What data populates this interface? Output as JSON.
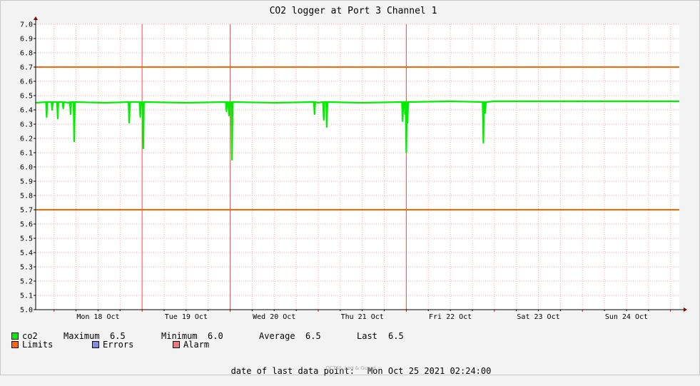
{
  "chart_data": {
    "type": "line",
    "title": "CO2 logger at Port 3 Channel 1",
    "x_tick_labels": [
      "Mon 18 Oct",
      "Tue 19 Oct",
      "Wed 20 Oct",
      "Thu 21 Oct",
      "Fri 22 Oct",
      "Sat 23 Oct",
      "Sun 24 Oct"
    ],
    "xlim": [
      "2021-10-17 19:00",
      "2021-10-25 02:24"
    ],
    "ylim": [
      5.0,
      7.0
    ],
    "y_ticks": [
      "5.0",
      "5.1",
      "5.2",
      "5.3",
      "5.4",
      "5.5",
      "5.6",
      "5.7",
      "5.8",
      "5.9",
      "6.0",
      "6.1",
      "6.2",
      "6.3",
      "6.4",
      "6.5",
      "6.6",
      "6.7",
      "6.8",
      "6.9",
      "7.0"
    ],
    "grid": true,
    "limits": [
      5.7,
      6.7
    ],
    "alarm_times": [
      "2021-10-19 00:00",
      "2021-10-20 00:00",
      "2021-10-22 00:00"
    ],
    "series": [
      {
        "name": "co2",
        "color": "#00ee00",
        "baseline": 6.455,
        "points": [
          [
            "2021-10-17 19:00",
            6.45
          ],
          [
            "2021-10-18 04:00",
            6.45
          ],
          [
            "2021-10-18 14:00",
            6.45
          ],
          [
            "2021-10-19 00:00",
            6.45
          ],
          [
            "2021-10-19 12:00",
            6.45
          ],
          [
            "2021-10-20 00:00",
            6.45
          ],
          [
            "2021-10-20 12:00",
            6.45
          ],
          [
            "2021-10-21 00:00",
            6.45
          ],
          [
            "2021-10-21 12:00",
            6.45
          ],
          [
            "2021-10-22 00:00",
            6.46
          ],
          [
            "2021-10-22 12:00",
            6.46
          ],
          [
            "2021-10-23 00:00",
            6.46
          ],
          [
            "2021-10-23 12:00",
            6.46
          ],
          [
            "2021-10-24 00:00",
            6.46
          ],
          [
            "2021-10-24 12:00",
            6.46
          ],
          [
            "2021-10-25 02:24",
            6.46
          ]
        ],
        "dips": [
          [
            "2021-10-17 22:00",
            6.35
          ],
          [
            "2021-10-17 23:30",
            6.4
          ],
          [
            "2021-10-18 01:00",
            6.34
          ],
          [
            "2021-10-18 02:30",
            6.41
          ],
          [
            "2021-10-18 04:30",
            6.37
          ],
          [
            "2021-10-18 05:30",
            6.18
          ],
          [
            "2021-10-18 20:30",
            6.31
          ],
          [
            "2021-10-18 23:30",
            6.35
          ],
          [
            "2021-10-19 00:20",
            6.13
          ],
          [
            "2021-10-19 23:00",
            6.39
          ],
          [
            "2021-10-19 23:40",
            6.36
          ],
          [
            "2021-10-20 00:30",
            6.05
          ],
          [
            "2021-10-20 23:00",
            6.37
          ],
          [
            "2021-10-21 01:30",
            6.33
          ],
          [
            "2021-10-21 02:20",
            6.28
          ],
          [
            "2021-10-21 23:00",
            6.32
          ],
          [
            "2021-10-21 23:40",
            6.37
          ],
          [
            "2021-10-22 00:00",
            6.1
          ],
          [
            "2021-10-22 00:20",
            6.31
          ],
          [
            "2021-10-22 21:00",
            6.17
          ],
          [
            "2021-10-22 21:30",
            6.38
          ]
        ]
      }
    ]
  },
  "legend": {
    "co2": {
      "label": "co2",
      "color": "#00ee00",
      "maximum_label": "Maximum",
      "maximum": "6.5",
      "minimum_label": "Minimum",
      "minimum": "6.0",
      "average_label": "Average",
      "average": "6.5",
      "last_label": "Last",
      "last": "6.5"
    },
    "limits": {
      "label": "Limits",
      "color": "#ff6600"
    },
    "errors": {
      "label": "Errors",
      "color": "#7f8fe8"
    },
    "alarm": {
      "label": "Alarm",
      "color": "#f07878"
    }
  },
  "footer": {
    "label": "date of last data point:",
    "value": "Mon Oct 25 2021 02:24:00",
    "brand": "OCTA& Log & Guard"
  }
}
